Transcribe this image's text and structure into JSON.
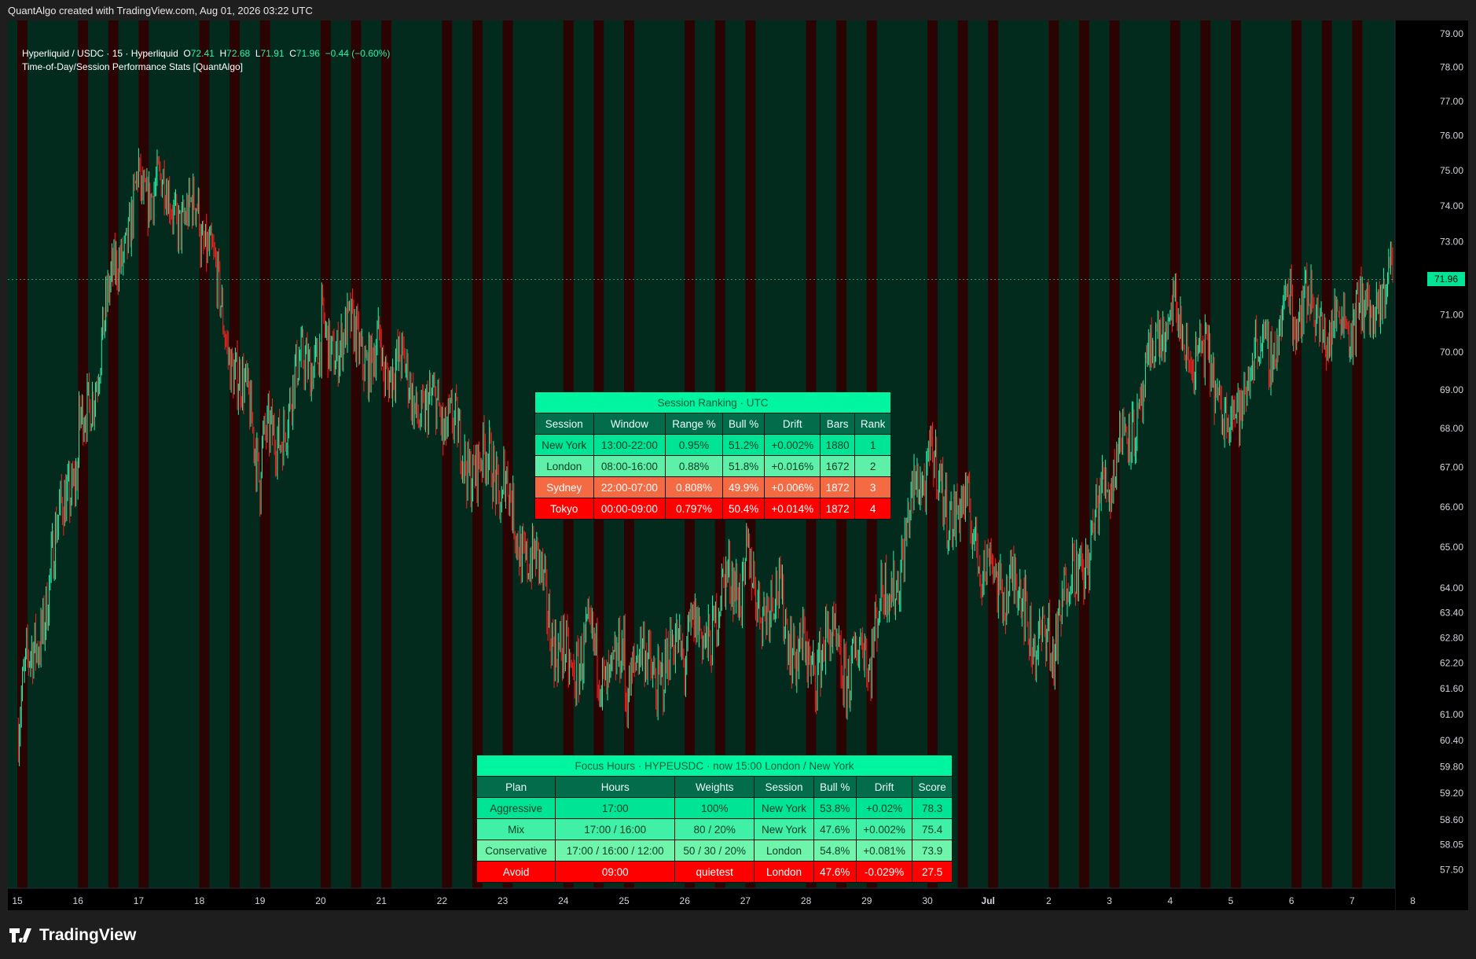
{
  "credit": "QuantAlgo created with TradingView.com, Aug 01, 2026 03:22 UTC",
  "legend": {
    "symbol": "Hyperliquid / USDC · 15 · Hyperliquid",
    "o_label": "O",
    "o_value": "72.41",
    "h_label": "H",
    "h_value": "72.68",
    "l_label": "L",
    "l_value": "71.91",
    "c_label": "C",
    "c_value": "71.96",
    "change": "−0.44 (−0.60%)",
    "indicator": "Time-of-Day/Session Performance Stats [QuantAlgo]"
  },
  "last_price_label": "71.96",
  "brand": "TradingView",
  "colors": {
    "bull": "#2cf0a8",
    "bear": "#ff1f1f",
    "session_green": "#022b1e",
    "session_red": "#2b0303",
    "price_tag": "#00e496"
  },
  "session_table": {
    "title": "Session Ranking · UTC",
    "headers": [
      "Session",
      "Window",
      "Range %",
      "Bull %",
      "Drift",
      "Bars",
      "Rank"
    ],
    "rows": [
      [
        "New York",
        "13:00-22:00",
        "0.95%",
        "51.2%",
        "+0.002%",
        "1880",
        "1"
      ],
      [
        "London",
        "08:00-16:00",
        "0.88%",
        "51.8%",
        "+0.016%",
        "1672",
        "2"
      ],
      [
        "Sydney",
        "22:00-07:00",
        "0.808%",
        "49.9%",
        "+0.006%",
        "1872",
        "3"
      ],
      [
        "Tokyo",
        "00:00-09:00",
        "0.797%",
        "50.4%",
        "+0.014%",
        "1872",
        "4"
      ]
    ]
  },
  "focus_table": {
    "title": "Focus Hours · HYPEUSDC · now 15:00 London / New York",
    "headers": [
      "Plan",
      "Hours",
      "Weights",
      "Session",
      "Bull %",
      "Drift",
      "Score"
    ],
    "rows": [
      [
        "Aggressive",
        "17:00",
        "100%",
        "New York",
        "53.8%",
        "+0.02%",
        "78.3"
      ],
      [
        "Mix",
        "17:00 / 16:00",
        "80 / 20%",
        "New York",
        "47.6%",
        "+0.002%",
        "75.4"
      ],
      [
        "Conservative",
        "17:00 / 16:00 / 12:00",
        "50 / 30 / 20%",
        "London",
        "54.8%",
        "+0.081%",
        "73.9"
      ],
      [
        "Avoid",
        "09:00",
        "quietest",
        "London",
        "47.6%",
        "-0.029%",
        "27.5"
      ]
    ]
  },
  "chart_data": {
    "type": "candlestick",
    "y_axis": {
      "scale": "log",
      "ticks": [
        79.0,
        78.0,
        77.0,
        76.0,
        75.0,
        74.0,
        73.0,
        71.0,
        70.0,
        69.0,
        68.0,
        67.0,
        66.0,
        65.0,
        64.0,
        63.4,
        62.8,
        62.2,
        61.6,
        61.0,
        60.4,
        59.8,
        59.2,
        58.6,
        58.05,
        57.5
      ],
      "range": [
        57.1,
        79.4
      ]
    },
    "x_axis": {
      "tick_labels": [
        "15",
        "16",
        "17",
        "18",
        "19",
        "20",
        "21",
        "22",
        "23",
        "24",
        "25",
        "26",
        "27",
        "28",
        "29",
        "30",
        "Jul",
        "2",
        "3",
        "4",
        "5",
        "6",
        "7",
        "8"
      ]
    },
    "last_price": 71.96,
    "series": [
      {
        "x": [
          "15",
          "16",
          "17",
          "18",
          "19",
          "20",
          "21",
          "22",
          "23",
          "24",
          "25",
          "26",
          "27",
          "28",
          "29",
          "30",
          "Jul",
          "2",
          "3",
          "4",
          "5",
          "6",
          "7"
        ],
        "values": [
          60.6,
          67.5,
          74.8,
          73.5,
          67.0,
          70.5,
          70.0,
          68.0,
          66.5,
          62.5,
          62.0,
          62.3,
          64.5,
          62.5,
          62.2,
          67.0,
          64.8,
          62.6,
          66.5,
          71.0,
          68.5,
          71.3,
          70.5
        ],
        "end_value": 72.0
      }
    ]
  }
}
